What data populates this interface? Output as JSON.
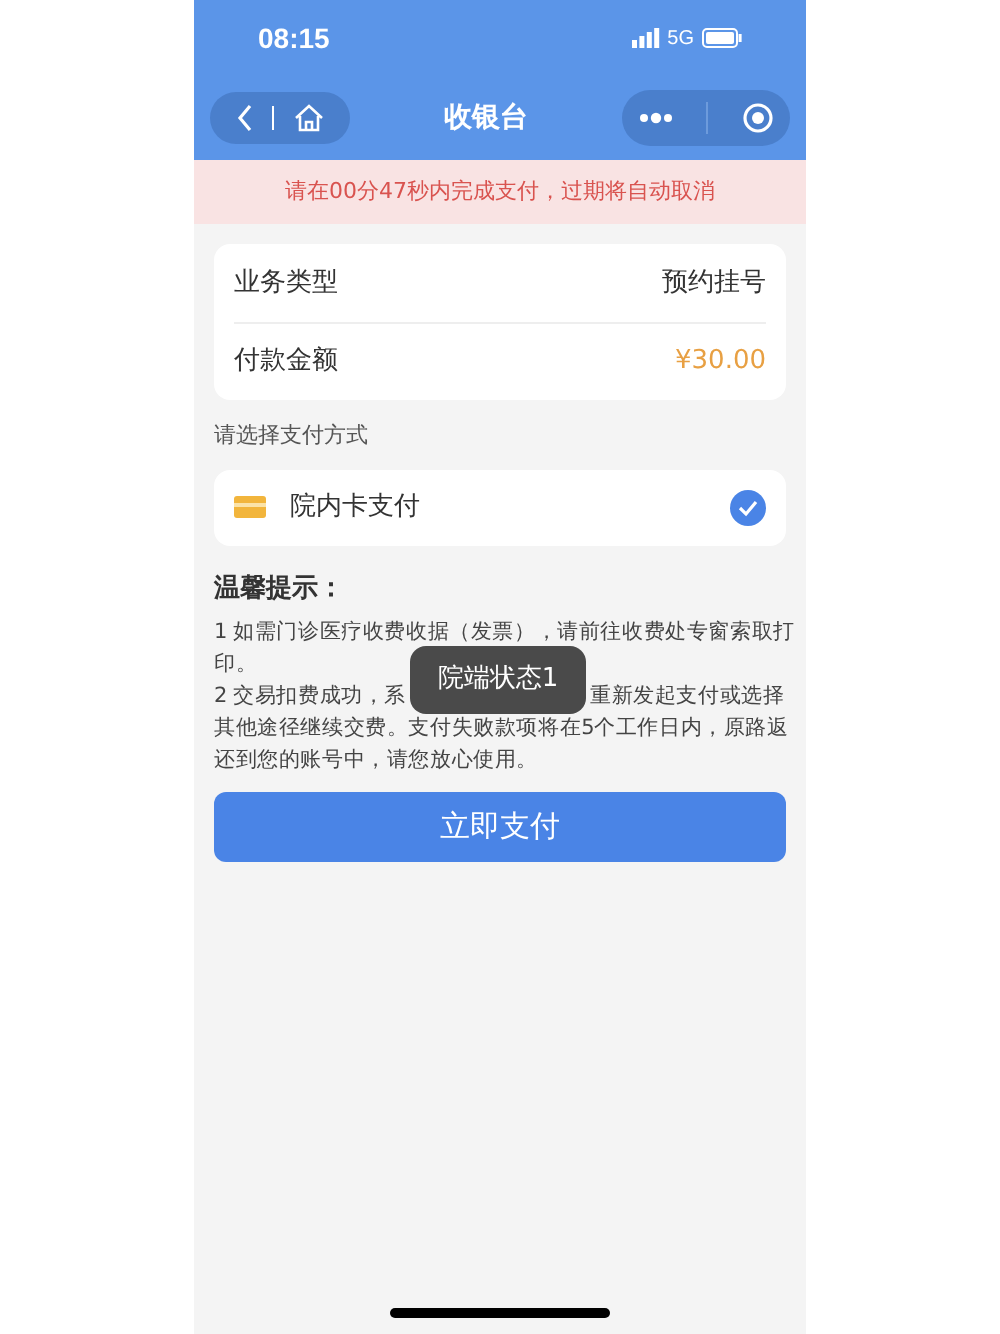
{
  "status_bar": {
    "time": "08:15",
    "network": "5G"
  },
  "nav": {
    "title": "收银台"
  },
  "banner": "请在00分47秒内完成支付，过期将自动取消",
  "order": [
    {
      "label": "业务类型",
      "value": "预约挂号",
      "kind": "plain"
    },
    {
      "label": "付款金额",
      "value": "¥30.00",
      "kind": "amount"
    }
  ],
  "section_label": "请选择支付方式",
  "payment_methods": [
    {
      "label": "院内卡支付",
      "selected": true
    }
  ],
  "tips": {
    "title": "温馨提示：",
    "lines": [
      [
        "1 如需门诊医疗收费收据（发票），请前往收费处专窗索取打"
      ],
      [
        "印。"
      ],
      [
        "2 交易扣费成功，系",
        "重新发起支付或选择"
      ],
      [
        "其他途径继续交费。支付失败款项将在5个工作日内，原路返"
      ],
      [
        "还到您的账号中，请您放心使用。"
      ]
    ]
  },
  "pay_button": "立即支付",
  "toast": "院端状态1"
}
